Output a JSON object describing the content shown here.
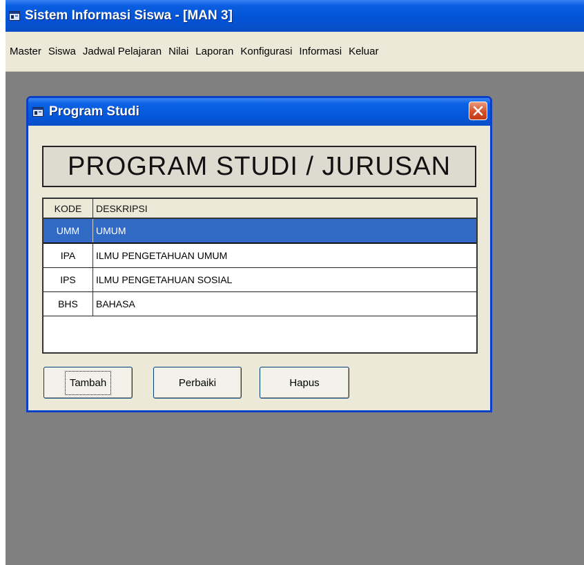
{
  "app": {
    "title": "Sistem Informasi Siswa - [MAN 3]",
    "icon": "window-app-icon"
  },
  "menu": {
    "items": [
      {
        "label": "Master"
      },
      {
        "label": "Siswa"
      },
      {
        "label": "Jadwal Pelajaran"
      },
      {
        "label": "Nilai"
      },
      {
        "label": "Laporan"
      },
      {
        "label": "Konfigurasi"
      },
      {
        "label": "Informasi"
      },
      {
        "label": "Keluar"
      }
    ]
  },
  "dialog": {
    "title": "Program Studi",
    "heading": "PROGRAM STUDI / JURUSAN",
    "grid": {
      "columns": [
        "KODE",
        "DESKRIPSI"
      ],
      "rows": [
        {
          "kode": "UMM",
          "deskripsi": "UMUM",
          "selected": true
        },
        {
          "kode": "IPA",
          "deskripsi": "ILMU PENGETAHUAN UMUM",
          "selected": false
        },
        {
          "kode": "IPS",
          "deskripsi": "ILMU PENGETAHUAN SOSIAL",
          "selected": false
        },
        {
          "kode": "BHS",
          "deskripsi": "BAHASA",
          "selected": false
        }
      ]
    },
    "buttons": {
      "tambah": "Tambah",
      "perbaiki": "Perbaiki",
      "hapus": "Hapus"
    }
  },
  "colors": {
    "titlebar": "#0352d6",
    "selection": "#316ac5",
    "close": "#d5502a",
    "workspace": "#808080",
    "face": "#ece9d8"
  }
}
